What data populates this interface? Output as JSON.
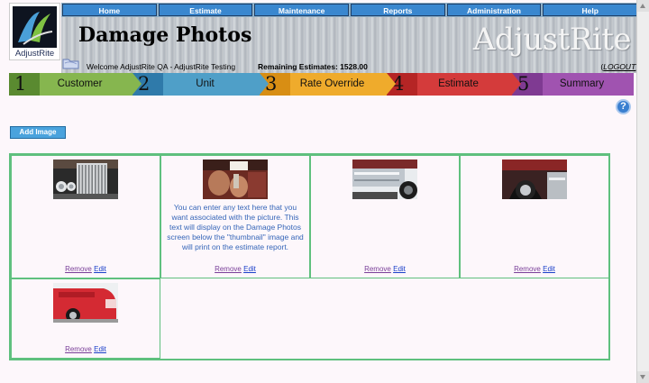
{
  "app": {
    "brand": "AdjustRite",
    "logo_word": "AdjustRite"
  },
  "nav": {
    "items": [
      "Home",
      "Estimate",
      "Maintenance",
      "Reports",
      "Administration",
      "Help"
    ]
  },
  "page": {
    "title": "Damage Photos"
  },
  "status": {
    "welcome": "Welcome AdjustRite QA - AdjustRite Testing",
    "remaining": "Remaining Estimates: 1528.00",
    "logout_open": "(",
    "logout": "LOGOUT",
    "logout_close": ")"
  },
  "steps": [
    {
      "num": "1",
      "label": "Customer",
      "color": "#86b64f",
      "numColor": "#5a8a30"
    },
    {
      "num": "2",
      "label": "Unit",
      "color": "#4f9fc8",
      "numColor": "#2f7aaa"
    },
    {
      "num": "3",
      "label": "Rate Override",
      "color": "#efab2c",
      "numColor": "#d88e14"
    },
    {
      "num": "4",
      "label": "Estimate",
      "color": "#d43b3b",
      "numColor": "#b52525"
    },
    {
      "num": "5",
      "label": "Summary",
      "color": "#a053b0",
      "numColor": "#7f3a92"
    }
  ],
  "help": {
    "label": "?"
  },
  "add_image": {
    "label": "Add Image"
  },
  "photos": [
    {
      "icon": "truck-grille-photo",
      "caption": "",
      "remove": "Remove",
      "edit": "Edit"
    },
    {
      "icon": "truck-interior-photo",
      "caption": "You can enter any text here that you want associated with the picture. This text will display on the Damage Photos screen below the \"thumbnail\" image and will print on the estimate report.",
      "remove": "Remove",
      "edit": "Edit"
    },
    {
      "icon": "truck-side-tank-photo",
      "caption": "",
      "remove": "Remove",
      "edit": "Edit"
    },
    {
      "icon": "truck-wheel-fender-photo",
      "caption": "",
      "remove": "Remove",
      "edit": "Edit"
    },
    {
      "icon": "red-truck-front-photo",
      "caption": "",
      "remove": "Remove",
      "edit": "Edit"
    }
  ]
}
